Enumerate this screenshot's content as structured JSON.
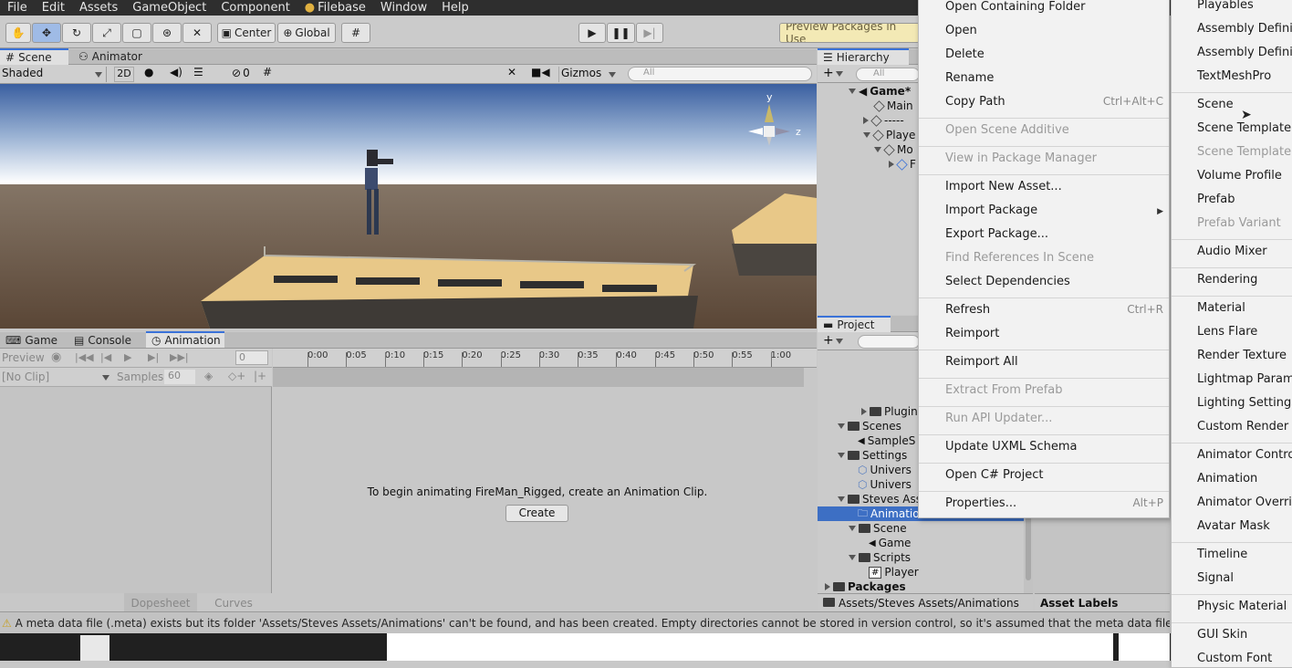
{
  "menubar": {
    "items": [
      "File",
      "Edit",
      "Assets",
      "GameObject",
      "Component",
      "Filebase",
      "Window",
      "Help"
    ]
  },
  "toolbar": {
    "center_label": "Center",
    "global_label": "Global",
    "preview_packages": "Preview Packages in Use"
  },
  "scene": {
    "tabs": [
      "Scene",
      "Animator"
    ],
    "shading_mode": "Shaded",
    "mode_2d": "2D",
    "hidden_count": "0",
    "gizmos_label": "Gizmos",
    "search_placeholder": "All",
    "gizmo_axes": {
      "y": "y",
      "z": "z"
    }
  },
  "hierarchy": {
    "tab": "Hierarchy",
    "search_placeholder": "All",
    "items": [
      "Game*",
      "Main",
      "-----",
      "Playe",
      "Mo",
      "F"
    ]
  },
  "bottom": {
    "tabs": [
      "Game",
      "Console",
      "Animation"
    ],
    "preview_label": "Preview",
    "frame_value": "0",
    "clip_select": "[No Clip]",
    "samples_label": "Samples",
    "samples_value": "60",
    "timeline_ticks": [
      "0:00",
      "0:05",
      "0:10",
      "0:15",
      "0:20",
      "0:25",
      "0:30",
      "0:35",
      "0:40",
      "0:45",
      "0:50",
      "0:55",
      "1:00"
    ],
    "message": "To begin animating FireMan_Rigged, create an Animation Clip.",
    "create_button": "Create",
    "dopesheet_tab": "Dopesheet",
    "curves_tab": "Curves"
  },
  "project": {
    "tab": "Project",
    "tree": [
      {
        "label": "Plugin",
        "kind": "folder"
      },
      {
        "label": "Scenes",
        "kind": "folder"
      },
      {
        "label": "SampleS",
        "kind": "scene"
      },
      {
        "label": "Settings",
        "kind": "folder"
      },
      {
        "label": "Univers",
        "kind": "asset"
      },
      {
        "label": "Univers",
        "kind": "asset"
      },
      {
        "label": "Steves Ass",
        "kind": "folder"
      },
      {
        "label": "Animatio",
        "kind": "folder-selected"
      },
      {
        "label": "Scene",
        "kind": "folder"
      },
      {
        "label": "Game",
        "kind": "scene"
      },
      {
        "label": "Scripts",
        "kind": "folder"
      },
      {
        "label": "Player",
        "kind": "script"
      },
      {
        "label": "Packages",
        "kind": "folder"
      }
    ],
    "path": "Assets/Steves Assets/Animations",
    "asset_labels": "Asset Labels"
  },
  "context_menu": {
    "items": [
      {
        "label": "Open Containing Folder",
        "shortcut": "",
        "disabled": false,
        "sep_after": false
      },
      {
        "label": "Open",
        "shortcut": "",
        "disabled": false,
        "sep_after": false
      },
      {
        "label": "Delete",
        "shortcut": "",
        "disabled": false,
        "sep_after": false
      },
      {
        "label": "Rename",
        "shortcut": "",
        "disabled": false,
        "sep_after": false
      },
      {
        "label": "Copy Path",
        "shortcut": "Ctrl+Alt+C",
        "disabled": false,
        "sep_after": true
      },
      {
        "label": "Open Scene Additive",
        "shortcut": "",
        "disabled": true,
        "sep_after": true
      },
      {
        "label": "View in Package Manager",
        "shortcut": "",
        "disabled": true,
        "sep_after": true
      },
      {
        "label": "Import New Asset...",
        "shortcut": "",
        "disabled": false,
        "sep_after": false
      },
      {
        "label": "Import Package",
        "shortcut": "",
        "disabled": false,
        "submenu": true,
        "sep_after": false
      },
      {
        "label": "Export Package...",
        "shortcut": "",
        "disabled": false,
        "sep_after": false
      },
      {
        "label": "Find References In Scene",
        "shortcut": "",
        "disabled": true,
        "sep_after": false
      },
      {
        "label": "Select Dependencies",
        "shortcut": "",
        "disabled": false,
        "sep_after": true
      },
      {
        "label": "Refresh",
        "shortcut": "Ctrl+R",
        "disabled": false,
        "sep_after": false
      },
      {
        "label": "Reimport",
        "shortcut": "",
        "disabled": false,
        "sep_after": true
      },
      {
        "label": "Reimport All",
        "shortcut": "",
        "disabled": false,
        "sep_after": true
      },
      {
        "label": "Extract From Prefab",
        "shortcut": "",
        "disabled": true,
        "sep_after": true
      },
      {
        "label": "Run API Updater...",
        "shortcut": "",
        "disabled": true,
        "sep_after": true
      },
      {
        "label": "Update UXML Schema",
        "shortcut": "",
        "disabled": false,
        "sep_after": true
      },
      {
        "label": "Open C# Project",
        "shortcut": "",
        "disabled": false,
        "sep_after": true
      },
      {
        "label": "Properties...",
        "shortcut": "Alt+P",
        "disabled": false,
        "sep_after": false
      }
    ]
  },
  "submenu": {
    "items": [
      {
        "label": "Playables",
        "disabled": false,
        "sep_after": false
      },
      {
        "label": "Assembly Definiti",
        "disabled": false,
        "sep_after": false
      },
      {
        "label": "Assembly Definiti",
        "disabled": false,
        "sep_after": false
      },
      {
        "label": "TextMeshPro",
        "disabled": false,
        "sep_after": true
      },
      {
        "label": "Scene",
        "disabled": false,
        "sep_after": false
      },
      {
        "label": "Scene Template",
        "disabled": false,
        "sep_after": false
      },
      {
        "label": "Scene Template F",
        "disabled": true,
        "sep_after": false
      },
      {
        "label": "Volume Profile",
        "disabled": false,
        "sep_after": false
      },
      {
        "label": "Prefab",
        "disabled": false,
        "sep_after": false
      },
      {
        "label": "Prefab Variant",
        "disabled": true,
        "sep_after": true
      },
      {
        "label": "Audio Mixer",
        "disabled": false,
        "sep_after": true
      },
      {
        "label": "Rendering",
        "disabled": false,
        "sep_after": true
      },
      {
        "label": "Material",
        "disabled": false,
        "sep_after": false
      },
      {
        "label": "Lens Flare",
        "disabled": false,
        "sep_after": false
      },
      {
        "label": "Render Texture",
        "disabled": false,
        "sep_after": false
      },
      {
        "label": "Lightmap Parame",
        "disabled": false,
        "sep_after": false
      },
      {
        "label": "Lighting Settings",
        "disabled": false,
        "sep_after": false
      },
      {
        "label": "Custom Render Te",
        "disabled": false,
        "sep_after": true
      },
      {
        "label": "Animator Control",
        "disabled": false,
        "sep_after": false
      },
      {
        "label": "Animation",
        "disabled": false,
        "sep_after": false
      },
      {
        "label": "Animator Overrid",
        "disabled": false,
        "sep_after": false
      },
      {
        "label": "Avatar Mask",
        "disabled": false,
        "sep_after": true
      },
      {
        "label": "Timeline",
        "disabled": false,
        "sep_after": false
      },
      {
        "label": "Signal",
        "disabled": false,
        "sep_after": true
      },
      {
        "label": "Physic Material",
        "disabled": false,
        "sep_after": true
      },
      {
        "label": "GUI Skin",
        "disabled": false,
        "sep_after": false
      },
      {
        "label": "Custom Font",
        "disabled": false,
        "sep_after": false
      }
    ]
  },
  "status": {
    "message": "A meta data file (.meta) exists but its folder 'Assets/Steves Assets/Animations' can't be found, and has been created. Empty directories cannot be stored in version control, so it's assumed that the meta data file is for an empty dire"
  },
  "colors": {
    "accent": "#3a72d8",
    "selection": "#3d6fc4",
    "sky_top": "#3a5fa0",
    "ground": "#6b5640"
  }
}
